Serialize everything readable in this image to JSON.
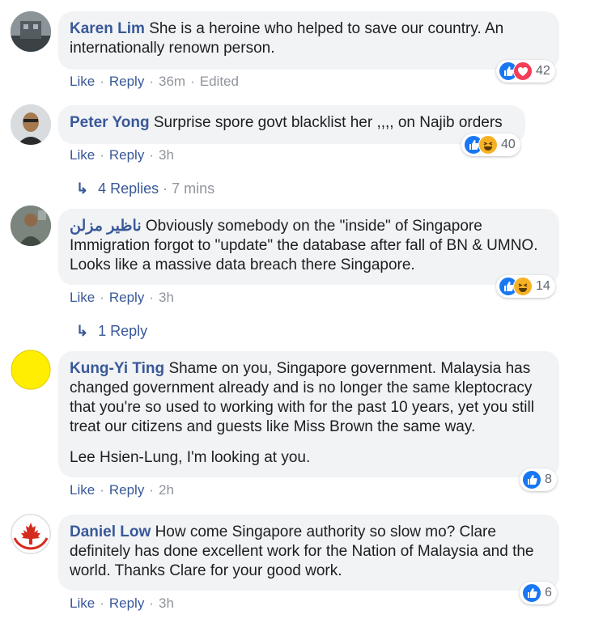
{
  "comments": [
    {
      "author": "Karen Lim",
      "text": "She is a heroine who helped to save our country. An internationally renown person.",
      "actions": {
        "like": "Like",
        "reply": "Reply",
        "time": "36m",
        "edited": "Edited"
      },
      "reactions": {
        "icons": [
          "like",
          "love"
        ],
        "count": "42"
      }
    },
    {
      "author": "Peter Yong",
      "text": "Surprise spore govt blacklist her ,,,, on Najib orders",
      "actions": {
        "like": "Like",
        "reply": "Reply",
        "time": "3h"
      },
      "reactions": {
        "icons": [
          "like",
          "haha"
        ],
        "count": "40"
      },
      "replies": {
        "label": "4 Replies",
        "time": "7 mins"
      }
    },
    {
      "author": "ناظير مزلن",
      "text": "Obviously somebody on the \"inside\" of Singapore Immigration forgot to \"update\" the database after fall of BN & UMNO. Looks like a massive data breach there Singapore.",
      "actions": {
        "like": "Like",
        "reply": "Reply",
        "time": "3h"
      },
      "reactions": {
        "icons": [
          "like",
          "haha"
        ],
        "count": "14"
      },
      "replies": {
        "label": "1 Reply"
      }
    },
    {
      "author": "Kung-Yi Ting",
      "text": "Shame on you, Singapore government. Malaysia has changed government already and is no longer the same kleptocracy that you're so used to working with for the past 10 years, yet you still treat our citizens and guests like Miss Brown the same way.",
      "text2": "Lee Hsien-Lung, I'm looking at you.",
      "actions": {
        "like": "Like",
        "reply": "Reply",
        "time": "2h"
      },
      "reactions": {
        "icons": [
          "like"
        ],
        "count": "8"
      }
    },
    {
      "author": "Daniel Low",
      "text": "How come Singapore authority so slow mo? Clare definitely has done excellent work for the Nation of Malaysia and the world. Thanks Clare for your good work.",
      "actions": {
        "like": "Like",
        "reply": "Reply",
        "time": "3h"
      },
      "reactions": {
        "icons": [
          "like"
        ],
        "count": "6"
      }
    }
  ],
  "colors": {
    "link": "#385898",
    "meta": "#90949c",
    "bubble": "#f2f3f5",
    "like": "#1877f2",
    "love": "#f33e58",
    "haha": "#f7b125"
  }
}
